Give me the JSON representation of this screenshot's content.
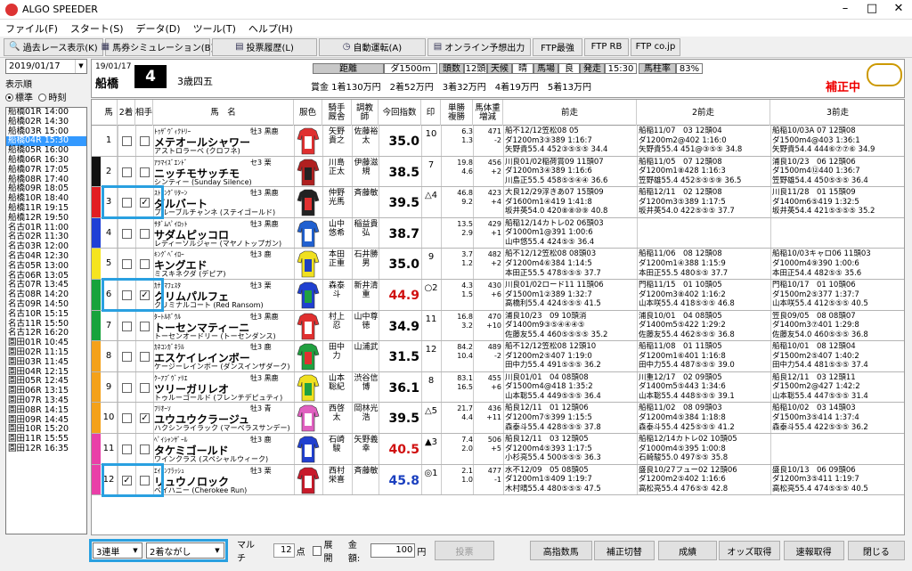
{
  "app": {
    "title": "ALGO SPEEDER"
  },
  "menu": [
    "ファイル(F)",
    "スタート(S)",
    "データ(D)",
    "ツール(T)",
    "ヘルプ(H)"
  ],
  "toolbar": [
    "過去レース表示(K)",
    "馬券シミュレーション(B)",
    "投票履歴(L)",
    "自動運転(A)",
    "オンライン予想出力",
    "FTP最強",
    "FTP RB",
    "FTP co.jp"
  ],
  "side": {
    "date": "2019/01/17",
    "order_label": "表示順",
    "opt1": "標準",
    "opt2": "時刻",
    "races": [
      "船橋01R 14:00",
      "船橋02R 14:30",
      "船橋03R 15:00",
      "船橋04R 15:30",
      "船橋05R 16:00",
      "船橋06R 16:30",
      "船橋07R 17:05",
      "船橋08R 17:40",
      "船橋09R 18:05",
      "船橋10R 18:40",
      "船橋11R 19:15",
      "船橋12R 19:50",
      "名古01R 11:00",
      "名古02R 11:30",
      "名古03R 12:00",
      "名古04R 12:30",
      "名古05R 13:00",
      "名古06R 13:05",
      "名古07R 13:45",
      "名古08R 14:20",
      "名古09R 14:50",
      "名古10R 15:15",
      "名古11R 15:50",
      "名古12R 16:20",
      "園田01R 10:45",
      "園田02R 11:15",
      "園田03R 11:45",
      "園田04R 12:15",
      "園田05R 12:45",
      "園田06R 13:15",
      "園田07R 13:45",
      "園田08R 14:15",
      "園田09R 14:45",
      "園田10R 15:20",
      "園田11R 15:55",
      "園田12R 16:35"
    ]
  },
  "race": {
    "date": "19/01/17",
    "course": "船橋",
    "no": "4",
    "class": "3歳四五",
    "dist_label": "距離",
    "dist": "ダ1500m",
    "heads_label": "頭数",
    "heads": "12頭",
    "weather_label": "天候",
    "weather": "晴",
    "track_label": "馬場",
    "track": "良",
    "post_label": "発走",
    "post": "15:30",
    "rate_label": "馬柱率",
    "rate": "83%",
    "prize": "賞金 1着130万円　2着52万円　3着32万円　4着19万円　5着13万円",
    "flag": "補正中"
  },
  "cols": [
    "馬",
    "2着",
    "相手",
    "馬　名",
    "服色",
    "騎手\n厩舎",
    "調教\n師",
    "今回指数",
    "印",
    "単勝\n複勝",
    "馬体重\n増減",
    "前走",
    "2前走",
    "3前走"
  ],
  "colors": {
    "w1": "#ffffff",
    "w2": "#111111",
    "w3": "#e21d22",
    "w4": "#1e3fd6",
    "w5": "#f5e41f",
    "w6": "#18a33c",
    "w7": "#f4a11a",
    "w8": "#e93fa8"
  },
  "horses": [
    {
      "no": "1",
      "w": "w1",
      "c2": false,
      "ai": false,
      "sire": "ﾄｩｻﾞｳﾞｨｸﾄﾘｰ",
      "name": "メテオールシャワー",
      "dam": "アストロラーベ (クロフネ)",
      "sex": "牡3 黒鹿",
      "jk": "矢野貴之",
      "tr": "佐藤裕太",
      "idx": "35.0",
      "idxc": "#000",
      "mk": "10",
      "ov": "6.3\n1.3",
      "wt": "471\n-2",
      "silk": [
        "#e03030",
        "#fff"
      ],
      "p1": [
        "船不12/12笠松08 05",
        "ダ1200m3③389 1:16:7",
        "矢野貴55.4 452③⑤⑤⑤ 34.4"
      ],
      "p2": [
        "船稲11/07　03 12頭04",
        "ダ1200m2@402 1:16:0",
        "矢野貴55.4 451@③⑤⑤ 34.8"
      ],
      "p3": [
        "船稲10/03A 07 12頭08",
        "ダ1500m4@403 1:36:1",
        "矢野貴54.4 444⑥⑦⑦⑥ 34.9"
      ]
    },
    {
      "no": "2",
      "w": "w2",
      "c2": false,
      "ai": false,
      "sire": "ｱﾂﾏｲｽﾞｴﾝﾄﾞ",
      "name": "ニッチモサッチモ",
      "dam": "シンティー (Sunday Silence)",
      "sex": "セ3 栗",
      "jk": "川島正太",
      "tr": "伊藤滋規",
      "idx": "38.5",
      "idxc": "#000",
      "mk": "7",
      "ov": "19.8\n4.6",
      "wt": "456\n+2",
      "silk": [
        "#b02020",
        "#222"
      ],
      "p1": [
        "川良01/02稲荷賞09 11頭07",
        "ダ1200m3④389 1:16:6",
        "川島正55.5 458⑤⑤④④ 36.6"
      ],
      "p2": [
        "船稲11/05　07 12頭08",
        "ダ1200m1⑧428 1:16:3",
        "笠野雄55.4 452⑤⑤⑤⑨ 36.5"
      ],
      "p3": [
        "浦良10/23　06 12頭06",
        "ダ1500m4⑫440 1:36:7",
        "笠野雄54.4 450⑤⑤⑤ 36.4"
      ]
    },
    {
      "no": "3",
      "w": "w3",
      "c2": false,
      "ai": true,
      "sire": "ｽﾄﾛﾝｸﾞﾘﾀｰﾝ",
      "name": "ダルバート",
      "dam": "ブルーブルチャンネ (ステイゴールド)",
      "sex": "牡3 黒鹿",
      "jk": "仲野光馬",
      "tr": "斉藤敏",
      "idx": "39.5",
      "idxc": "#000",
      "mk": "△4",
      "ov": "46.8\n9.2",
      "wt": "423\n+4",
      "silk": [
        "#222",
        "#e03030"
      ],
      "p1": [
        "大良12/29浮きあ07 15頭09",
        "ダ1600m1④419 1:41:8",
        "坂井英54.0 420⑧⑧⑩⑨ 40.8"
      ],
      "p2": [
        "船稲12/11　02 12頭08",
        "ダ1200m3⑤389 1:17:5",
        "坂井英54.0 422⑤⑤⑤ 37.7"
      ],
      "p3": [
        "川良11/28　01 15頭09",
        "ダ1400m6⑤419 1:32:5",
        "坂井英54.4 421⑤⑤⑤⑤ 35.2"
      ]
    },
    {
      "no": "4",
      "w": "w4",
      "c2": false,
      "ai": false,
      "sire": "ｻﾀﾞﾑﾊﾟｲﾛｯﾄ",
      "name": "サダムピッコロ",
      "dam": "レディーソルジャー (マヤノトップガン)",
      "sex": "牡3 黒鹿",
      "jk": "山中悠希",
      "tr": "稲益貴弘",
      "idx": "38.7",
      "idxc": "#000",
      "mk": "",
      "ov": "13.5\n2.9",
      "wt": "429\n+1",
      "silk": [
        "#2060d0",
        "#fff"
      ],
      "p1": [
        "船稲12/14カトレ02 06頭03",
        "ダ1000m1@391 1:00:6",
        "山中悠55.4 424⑤⑤ 36.4"
      ],
      "p2": [
        "",
        "",
        ""
      ],
      "p3": [
        "",
        "",
        ""
      ]
    },
    {
      "no": "5",
      "w": "w5",
      "c2": false,
      "ai": false,
      "sire": "ｷﾝｸﾞﾍﾞｲﾛｰ",
      "name": "キングエド",
      "dam": "ミスキネクダ (デピア)",
      "sex": "牡3 鹿",
      "jk": "本田正重",
      "tr": "石井勝男",
      "idx": "35.0",
      "idxc": "#000",
      "mk": "9",
      "ov": "3.7\n1.2",
      "wt": "482\n+2",
      "silk": [
        "#f0e020",
        "#2040c0"
      ],
      "p1": [
        "船不12/12笠松08 08頭03",
        "ダ1200m4⑥384 1:14:5",
        "本田正55.5 478⑤⑤⑤ 37.7"
      ],
      "p2": [
        "船稲11/06　08 12頭08",
        "ダ1200m1④388 1:15:9",
        "本田正55.5 480⑤⑤ 37.7"
      ],
      "p3": [
        "船稲10/03キャロ06 11頭03",
        "ダ1000m4⑨390 1:00:6",
        "本田正54.4 482⑤⑤ 35.6"
      ]
    },
    {
      "no": "6",
      "w": "w6",
      "c2": false,
      "ai": true,
      "sire": "ｶﾅｶﾏﾌｪｽﾀ",
      "name": "クリムパルフェ",
      "dam": "クリミナルコート (Red Ransom)",
      "sex": "牡3 栗",
      "jk": "森泰斗",
      "tr": "新井清重",
      "idx": "44.9",
      "idxc": "#d01010",
      "mk": "○2",
      "ov": "4.3\n1.5",
      "wt": "430\n+6",
      "silk": [
        "#2040d0",
        "#20a040"
      ],
      "p1": [
        "川良01/02ロード11 11頭06",
        "ダ1500m1②389 1:32:7",
        "高橋利55.4 424⑤⑤⑤ 41.5"
      ],
      "p2": [
        "門稲11/15　01 10頭05",
        "ダ1200m3⑧402 1:16:2",
        "山本咲55.4 418⑤⑤⑤ 46.8"
      ],
      "p3": [
        "門稲10/17　01 10頭06",
        "ダ1500m2⑤377 1:37:7",
        "山本咲55.4 412⑤⑤⑤ 40.5"
      ]
    },
    {
      "no": "7",
      "w": "w6",
      "c2": false,
      "ai": false,
      "sire": "ﾀｰﾄﾙﾎﾞｳﾙ",
      "name": "トーセンマティーニ",
      "dam": "トーセンオードリー (トーセンダンス)",
      "sex": "牡3 黒鹿",
      "jk": "村上忍",
      "tr": "山中尊徳",
      "idx": "34.9",
      "idxc": "#000",
      "mk": "11",
      "ov": "16.8\n3.2",
      "wt": "470\n+10",
      "silk": [
        "#e03030",
        "#fff"
      ],
      "p1": [
        "浦良10/23　09 10頭消",
        "ダ1400m9③⑤④④④⑤",
        "佐藤友55.4 460⑤⑤⑤⑤ 35.2"
      ],
      "p2": [
        "浦良10/01　04 08頭05",
        "ダ1400m5⑤422 1:29:2",
        "佐藤友55.4 462⑤⑤⑤ 36.8"
      ],
      "p3": [
        "笠良09/05　08 08頭07",
        "ダ1400m3⑦401 1:29:8",
        "佐藤友54.0 460⑤⑤⑤ 36.8"
      ]
    },
    {
      "no": "8",
      "w": "w7",
      "c2": false,
      "ai": false,
      "sire": "ｶﾈｺﾝｶﾞﾈﾗﾙ",
      "name": "エスケイレインボー",
      "dam": "ケージーレインボー (ダンスインザダーク)",
      "sex": "牡3 鹿",
      "jk": "田中力",
      "tr": "山浦武",
      "idx": "31.5",
      "idxc": "#000",
      "mk": "12",
      "ov": "84.2\n10.4",
      "wt": "489\n-2",
      "silk": [
        "#20a040",
        "#e03030"
      ],
      "p1": [
        "船不12/12笠松08 12頭10",
        "ダ1200m2⑤407 1:19:0",
        "田中力55.4 491⑤⑤⑤ 36.2"
      ],
      "p2": [
        "船稲11/08　01 11頭05",
        "ダ1200m1⑥401 1:16:8",
        "田中力55.4 487⑤⑤⑤ 39.0"
      ],
      "p3": [
        "船稲10/01　08 12頭04",
        "ダ1500m2⑤407 1:40:2",
        "田中力54.4 481⑤⑤⑤ 37.4"
      ]
    },
    {
      "no": "9",
      "w": "w7",
      "c2": false,
      "ai": false,
      "sire": "ｸｰｱﾌﾞｳﾞｧﾘｴ",
      "name": "ツリーガリレオ",
      "dam": "トゥルーゴールド (フレンチデピュティ)",
      "sex": "牡3 黒鹿",
      "jk": "山本聡紀",
      "tr": "渋谷信博",
      "idx": "36.1",
      "idxc": "#000",
      "mk": "8",
      "ov": "83.1\n16.5",
      "wt": "455\n+6",
      "silk": [
        "#f0e020",
        "#20a040"
      ],
      "p1": [
        "川良01/01　04 08頭08",
        "ダ1500m4@418 1:35:2",
        "山本聡55.4 449⑤⑤⑤ 36.4"
      ],
      "p2": [
        "川重12/17　02 09頭05",
        "ダ1400m5⑤443 1:34:6",
        "山本聡55.4 448⑤⑤⑤ 39.1"
      ],
      "p3": [
        "船良12/11　03 12頭11",
        "ダ1500m2@427 1:42:2",
        "山本聡55.4 447⑤⑤⑤ 31.4"
      ]
    },
    {
      "no": "10",
      "w": "w7",
      "c2": false,
      "ai": true,
      "sire": "ﾌﾘｵｰｿ",
      "name": "ユウユウクラージュ",
      "dam": "ハクシンライラック (マーベラスサンデー)",
      "sex": "牡3 青",
      "jk": "西啓太",
      "tr": "岡林光浩",
      "idx": "39.5",
      "idxc": "#000",
      "mk": "△5",
      "ov": "21.7\n4.4",
      "wt": "436\n+11",
      "silk": [
        "#e060c0",
        "#fff"
      ],
      "p1": [
        "船良12/11　01 12頭06",
        "ダ1200m7⑤399 1:15:5",
        "森泰斗55.4 428⑤⑤⑤ 37.8"
      ],
      "p2": [
        "船稲11/02　08 09頭03",
        "ダ1200m4⑤384 1:18:8",
        "森泰斗55.4 425⑤⑤⑤ 41.2"
      ],
      "p3": [
        "船稲10/02　03 14頭03",
        "ダ1500m3⑤414 1:37:4",
        "森泰斗55.4 422⑤⑤⑤ 36.2"
      ]
    },
    {
      "no": "11",
      "w": "w8",
      "c2": false,
      "ai": false,
      "sire": "ﾍﾟｲｼｬﾝｻﾞｰﾙ",
      "name": "タケミゴールド",
      "dam": "ワインクラス (スペシャルウィーク)",
      "sex": "牡3 鹿",
      "jk": "石崎駿",
      "tr": "矢野義幸",
      "idx": "40.5",
      "idxc": "#d01010",
      "mk": "▲3",
      "ov": "7.4\n2.0",
      "wt": "506\n+5",
      "silk": [
        "#2040d0",
        "#fff"
      ],
      "p1": [
        "船良12/11　03 12頭05",
        "ダ1200m4⑤393 1:17:5",
        "小杉亮55.4 500⑤⑤⑤ 36.3"
      ],
      "p2": [
        "船稲12/14カトレ02 10頭05",
        "ダ1000m4⑤395 1:00:8",
        "石崎駿55.0 497⑤⑤ 35.8"
      ],
      "p3": [
        "",
        "",
        ""
      ]
    },
    {
      "no": "12",
      "w": "w8",
      "c2": true,
      "ai": false,
      "sire": "ｴｲｼﾝﾌﾗｯｼｭ",
      "name": "リュウノロック",
      "dam": "ベイハニー (Cherokee Run)",
      "sex": "牡3 栗",
      "jk": "西村栄喜",
      "tr": "斉藤敏",
      "idx": "45.8",
      "idxc": "#1a3fbf",
      "mk": "◎1",
      "ov": "2.1\n1.0",
      "wt": "477\n-1",
      "silk": [
        "#c81a2a",
        "#fff"
      ],
      "p1": [
        "水不12/09　05 08頭05",
        "ダ1200m1⑤409 1:19:7",
        "木村晴55.4 480⑤⑤⑤ 47.5"
      ],
      "p2": [
        "盛良10/27フュー02 12頭06",
        "ダ1200m2⑤402 1:16:6",
        "高松亮55.4 476⑤⑤ 42.8"
      ],
      "p3": [
        "盛良10/13　06 09頭06",
        "ダ1200m3⑤411 1:19:7",
        "高松亮55.4 474⑤⑤⑤ 40.5"
      ]
    }
  ],
  "bottom": {
    "bet_type": "3連単",
    "method": "2着ながし",
    "multi": "マルチ",
    "points": "12",
    "points_unit": "点",
    "expand": "展開",
    "amount_label": "金額:",
    "amount": "100",
    "yen": "円",
    "vote": "投票",
    "b1": "高指数馬",
    "b2": "補正切替",
    "b3": "成績",
    "b4": "オッズ取得",
    "b5": "速報取得",
    "b6": "閉じる"
  }
}
